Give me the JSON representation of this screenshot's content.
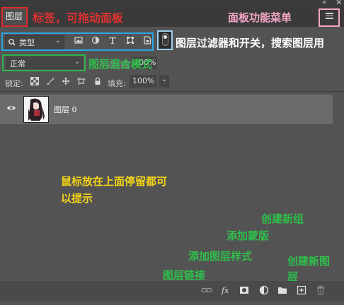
{
  "panel": {
    "tab_label": "图层",
    "filter_kind": "类型",
    "blend_mode": "正常",
    "opacity_label": "不透明度:",
    "opacity_value": "100%",
    "lock_label": "锁定:",
    "fill_label": "填充:",
    "fill_value": "100%"
  },
  "layers": [
    {
      "name": "图层 0",
      "visible": true
    }
  ],
  "annotations": {
    "tab": "标签，可拖动面板",
    "menu": "面板功能菜单",
    "filter": "图层过滤器和开关，搜索图层用",
    "blend": "图层混合模式",
    "hover": "鼠标放在上面停留都可以提示",
    "new_group": "创建新组",
    "add_mask": "添加蒙版",
    "add_style": "添加图层样式",
    "new_layer": "创建新图层",
    "link": "图层链接"
  },
  "icons": {
    "filter": [
      "search-icon",
      "image-filter-icon",
      "adjustment-filter-icon",
      "type-filter-icon",
      "shape-filter-icon",
      "smart-object-filter-icon"
    ],
    "lock": [
      "lock-transparent-icon",
      "lock-image-icon",
      "lock-position-icon",
      "lock-artboard-icon",
      "lock-all-icon"
    ],
    "bottom": [
      "link-icon",
      "fx-icon",
      "mask-icon",
      "adjustment-icon",
      "folder-icon",
      "new-layer-icon",
      "trash-icon"
    ]
  },
  "colors": {
    "panel_bg": "#535353",
    "selected_layer": "#6b6b6b",
    "annotation_red": "#e03131",
    "annotation_pink": "#f4a6c6",
    "annotation_blue": "#2aa7e8",
    "annotation_green": "#2fbf4a",
    "annotation_yellow": "#f5d416"
  }
}
